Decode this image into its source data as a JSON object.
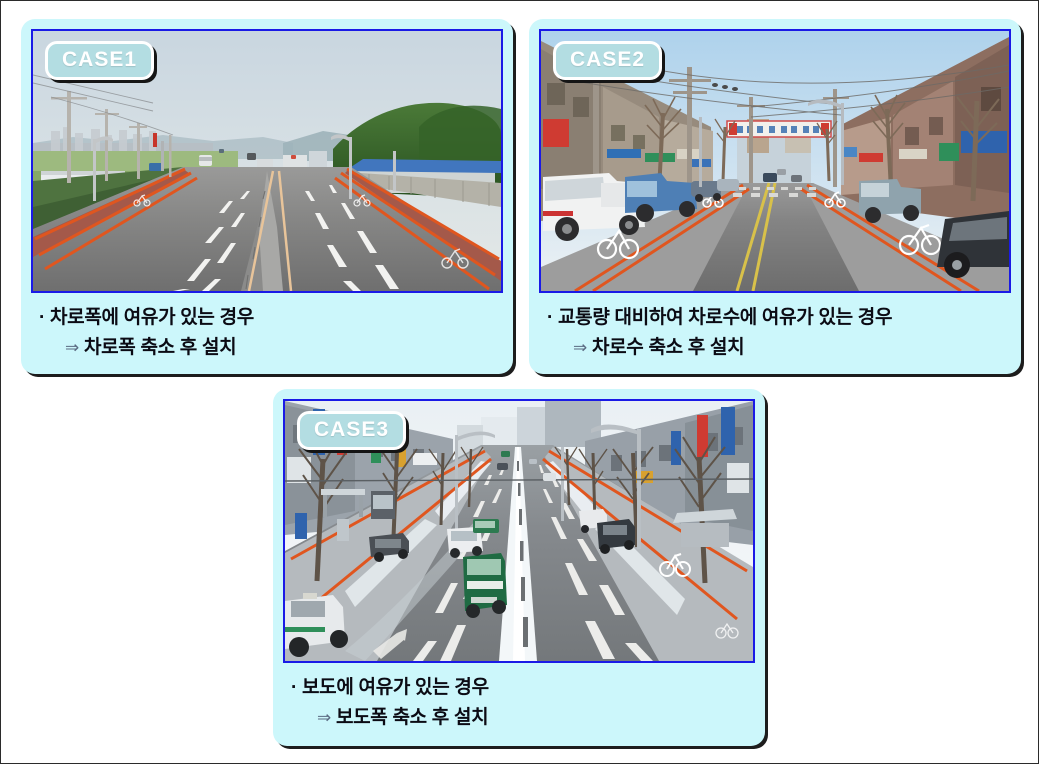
{
  "page": {
    "background": "#ffffff",
    "border_color": "#2b2b2b",
    "card_fill": "#ccf7fb",
    "photo_border": "#1a1ae6",
    "badge_fill": "#b3dde2",
    "badge_text_color": "#ffffff",
    "caption_text_color": "#0b0b14",
    "arrow_color": "#5a6b82",
    "bike_lane_marking": "#e0561f"
  },
  "cards": [
    {
      "id": "case1",
      "badge": "CASE1",
      "caption_line1": "· 차로폭에 여유가 있는 경우",
      "caption_arrow": "⇒",
      "caption_line2": "차로폭 축소 후 설치",
      "photo": {
        "alt": "왕복 다차로 도로 전경 - 갓길에 주황색 선으로 표시된 자전거도로",
        "scene": "rural-divided-highway",
        "season": "summer"
      }
    },
    {
      "id": "case2",
      "badge": "CASE2",
      "caption_line1": "· 교통량 대비하여 차로수에 여유가 있는 경우",
      "caption_arrow": "⇒",
      "caption_line2": "차로수 축소 후 설치",
      "photo": {
        "alt": "상가 밀집 이면도로 - 양측 회색 구간에 자전거 표시 및 주황색 경계선",
        "scene": "commercial-street",
        "season": "winter"
      }
    },
    {
      "id": "case3",
      "badge": "CASE3",
      "caption_line1": "· 보도에 여유가 있는 경우",
      "caption_arrow": "⇒",
      "caption_line2": "보도폭 축소 후 설치",
      "photo": {
        "alt": "겨울철 도심 간선도로 부감 - 보도측 주황색 자전거도로 표시",
        "scene": "urban-boulevard-aerial",
        "season": "winter"
      }
    }
  ]
}
